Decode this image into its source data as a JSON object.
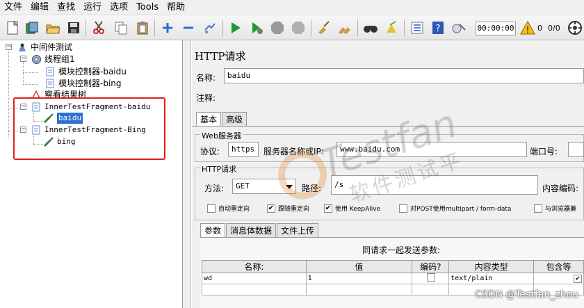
{
  "menu": [
    "文件",
    "编辑",
    "查找",
    "运行",
    "选项",
    "Tools",
    "帮助"
  ],
  "toolbar": {
    "icons": [
      "new-icon",
      "templates-icon",
      "open-icon",
      "save-icon",
      "cut-icon",
      "copy-icon",
      "paste-icon",
      "expand-icon",
      "collapse-icon",
      "toggle-icon",
      "start-icon",
      "start-no-pause-icon",
      "stop-icon",
      "shutdown-icon",
      "clear-icon",
      "clear-all-icon",
      "search-icon",
      "reset-search-icon",
      "function-helper-icon",
      "help-icon",
      "remote-icon"
    ],
    "timer": "00:00:00",
    "warning_count": "0",
    "threads": "0/0"
  },
  "tree": {
    "root": "中间件测试",
    "thread_group": "线程组1",
    "controller1": "模块控制器-baidu",
    "controller2": "模块控制器-bing",
    "listener": "察看结果树",
    "fragment1": "InnerTestFragment-baidu",
    "sampler1": "baidu",
    "fragment2": "InnerTestFragment-Bing",
    "sampler2": "bing"
  },
  "panel": {
    "title": "HTTP请求",
    "name_label": "名称:",
    "name_value": "baidu",
    "comment_label": "注释:",
    "tabs": [
      "基本",
      "高级"
    ],
    "web_server_title": "Web服务器",
    "protocol_label": "协议:",
    "protocol_value": "https",
    "server_label": "服务器名称或IP:",
    "server_value": "www.baidu.com",
    "port_label": "端口号:",
    "http_request_title": "HTTP请求",
    "method_label": "方法:",
    "method_value": "GET",
    "path_label": "路径:",
    "path_value": "/s",
    "encoding_label": "内容编码:",
    "checkboxes": [
      {
        "label": "自动重定向",
        "checked": false
      },
      {
        "label": "跟随重定向",
        "checked": true
      },
      {
        "label": "使用 KeepAlive",
        "checked": true
      },
      {
        "label": "对POST使用multipart / form-data",
        "checked": false
      },
      {
        "label": "与浏览器兼",
        "checked": false
      }
    ],
    "param_tabs": [
      "参数",
      "消息体数据",
      "文件上传"
    ],
    "params_caption": "同请求一起发送参数:",
    "columns": [
      "名称:",
      "值",
      "编码?",
      "内容类型",
      "包含等"
    ],
    "rows": [
      {
        "name": "wd",
        "value": "1",
        "encode": false,
        "content_type": "text/plain",
        "include_equals": true
      }
    ]
  },
  "watermark": {
    "brand": "Testfan",
    "subtitle": "软件测试平台",
    "csdn": "CSDN @Testfan_zhou"
  }
}
